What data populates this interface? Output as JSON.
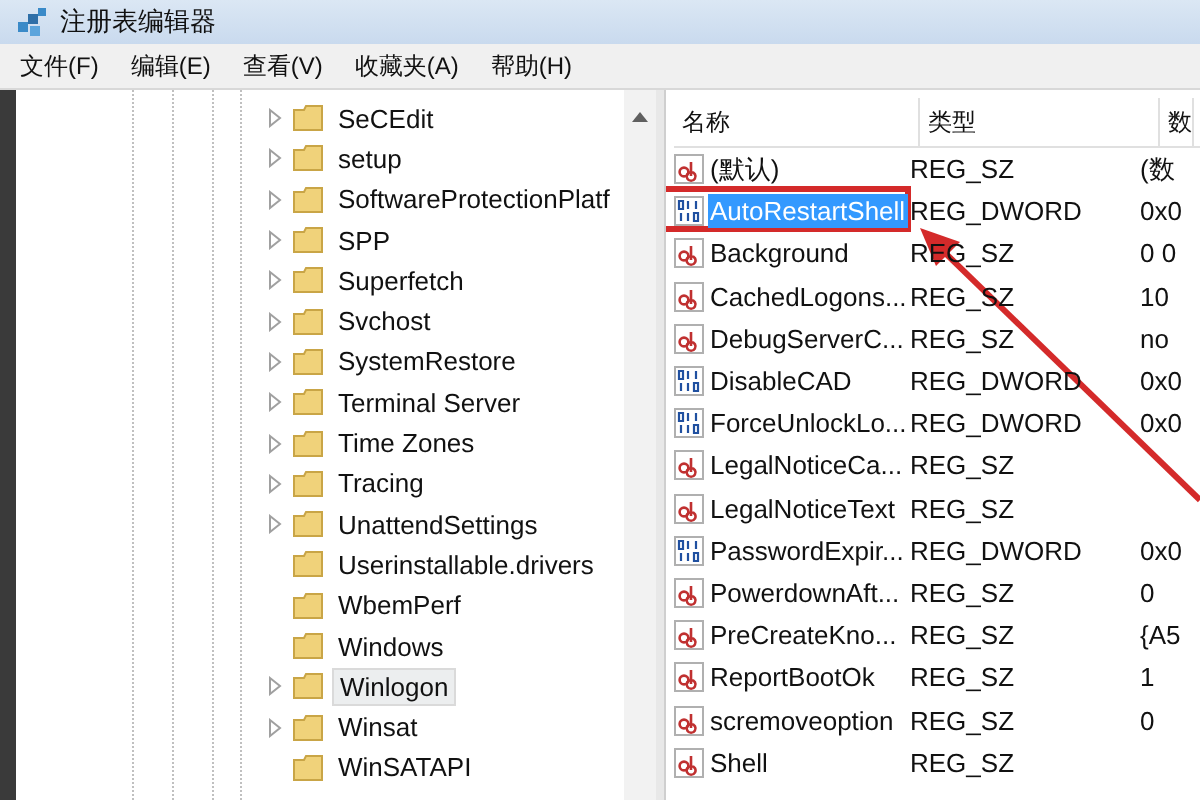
{
  "window": {
    "title": "注册表编辑器"
  },
  "menu": [
    "文件(F)",
    "编辑(E)",
    "查看(V)",
    "收藏夹(A)",
    "帮助(H)"
  ],
  "tree": {
    "items": [
      {
        "label": "SeCEdit",
        "expandable": true,
        "selected": false
      },
      {
        "label": "setup",
        "expandable": true,
        "selected": false
      },
      {
        "label": "SoftwareProtectionPlatf",
        "expandable": true,
        "selected": false
      },
      {
        "label": "SPP",
        "expandable": true,
        "selected": false
      },
      {
        "label": "Superfetch",
        "expandable": true,
        "selected": false
      },
      {
        "label": "Svchost",
        "expandable": true,
        "selected": false
      },
      {
        "label": "SystemRestore",
        "expandable": true,
        "selected": false
      },
      {
        "label": "Terminal Server",
        "expandable": true,
        "selected": false
      },
      {
        "label": "Time Zones",
        "expandable": true,
        "selected": false
      },
      {
        "label": "Tracing",
        "expandable": true,
        "selected": false
      },
      {
        "label": "UnattendSettings",
        "expandable": true,
        "selected": false
      },
      {
        "label": "Userinstallable.drivers",
        "expandable": false,
        "selected": false
      },
      {
        "label": "WbemPerf",
        "expandable": false,
        "selected": false
      },
      {
        "label": "Windows",
        "expandable": false,
        "selected": false
      },
      {
        "label": "Winlogon",
        "expandable": true,
        "selected": true
      },
      {
        "label": "Winsat",
        "expandable": true,
        "selected": false
      },
      {
        "label": "WinSATAPI",
        "expandable": false,
        "selected": false
      }
    ]
  },
  "values": {
    "columns": [
      "名称",
      "类型",
      "数"
    ],
    "rows": [
      {
        "kind": "string",
        "name": "(默认)",
        "type": "REG_SZ",
        "data": "(数",
        "selected": false
      },
      {
        "kind": "dword",
        "name": "AutoRestartShell",
        "type": "REG_DWORD",
        "data": "0x0",
        "selected": true
      },
      {
        "kind": "string",
        "name": "Background",
        "type": "REG_SZ",
        "data": "0 0",
        "selected": false
      },
      {
        "kind": "string",
        "name": "CachedLogons...",
        "type": "REG_SZ",
        "data": "10",
        "selected": false
      },
      {
        "kind": "string",
        "name": "DebugServerC...",
        "type": "REG_SZ",
        "data": "no",
        "selected": false
      },
      {
        "kind": "dword",
        "name": "DisableCAD",
        "type": "REG_DWORD",
        "data": "0x0",
        "selected": false
      },
      {
        "kind": "dword",
        "name": "ForceUnlockLo...",
        "type": "REG_DWORD",
        "data": "0x0",
        "selected": false
      },
      {
        "kind": "string",
        "name": "LegalNoticeCa...",
        "type": "REG_SZ",
        "selected": false
      },
      {
        "kind": "string",
        "name": "LegalNoticeText",
        "type": "REG_SZ",
        "selected": false
      },
      {
        "kind": "dword",
        "name": "PasswordExpir...",
        "type": "REG_DWORD",
        "data": "0x0",
        "selected": false
      },
      {
        "kind": "string",
        "name": "PowerdownAft...",
        "type": "REG_SZ",
        "data": "0",
        "selected": false
      },
      {
        "kind": "string",
        "name": "PreCreateKno...",
        "type": "REG_SZ",
        "data": "{A5",
        "selected": false
      },
      {
        "kind": "string",
        "name": "ReportBootOk",
        "type": "REG_SZ",
        "data": "1",
        "selected": false
      },
      {
        "kind": "string",
        "name": "scremoveoption",
        "type": "REG_SZ",
        "data": "0",
        "selected": false
      },
      {
        "kind": "string",
        "name": "Shell",
        "type": "REG_SZ",
        "selected": false
      }
    ]
  }
}
